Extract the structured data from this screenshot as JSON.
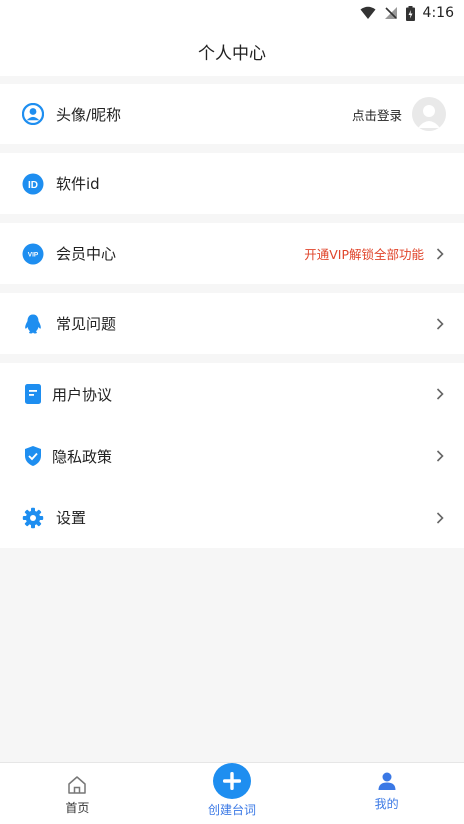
{
  "status_bar": {
    "time": "4:16"
  },
  "header": {
    "title": "个人中心"
  },
  "rows": {
    "profile": {
      "label": "头像/昵称",
      "right_text": "点击登录"
    },
    "software_id": {
      "label": "软件id"
    },
    "vip": {
      "label": "会员中心",
      "right_text": "开通VIP解锁全部功能"
    },
    "faq": {
      "label": "常见问题"
    },
    "agreement": {
      "label": "用户协议"
    },
    "privacy": {
      "label": "隐私政策"
    },
    "settings": {
      "label": "设置"
    }
  },
  "bottom_nav": {
    "home": "首页",
    "create": "创建台词",
    "mine": "我的"
  },
  "icons": {
    "id_badge_text": "ID",
    "vip_badge_text": "VIP"
  },
  "colors": {
    "accent_blue": "#1e8ef0",
    "promo_red": "#e0452b",
    "active_nav": "#3a78e5"
  }
}
